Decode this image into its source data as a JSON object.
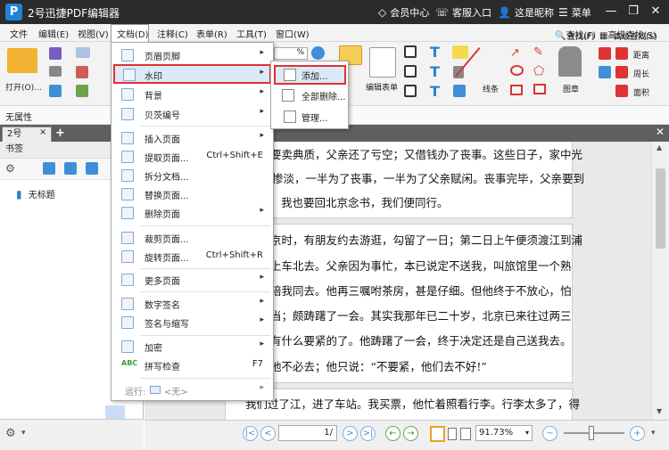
{
  "window": {
    "app_icon_letter": "P",
    "title": "2号迅捷PDF编辑器",
    "member_center": "会员中心",
    "support": "客服入口",
    "username": "这是昵称",
    "menu": "菜单"
  },
  "menubar": [
    "文件",
    "编辑(E)",
    "视图(V)",
    "文档(D)",
    "注释(C)",
    "表单(R)",
    "工具(T)",
    "窗口(W)"
  ],
  "ribbon": {
    "open": "打开(O)...",
    "zoom_value": "%",
    "edit_form": "编辑表单",
    "lines": "线条",
    "stamp": "图章",
    "find": "查找(F)",
    "advanced_find": "高级查找(S)",
    "distance": "距离",
    "perimeter": "周长",
    "area": "面积"
  },
  "property_bar": "无属性",
  "doc_tab": "2号",
  "sidebar": {
    "title": "书签",
    "bookmark": "无标题"
  },
  "page_lines": [
    "要卖典质，父亲还了亏空；又借钱办了丧事。这些日子，家中光",
    "惨淡，一半为了丧事，一半为了父亲赋闲。丧事完毕，父亲要到",
    "我也要回北京念书，我们便同行。",
    "京时，有朋友约去游逛，勾留了一日；第二日上午便须渡江到浦",
    "上车北去。父亲因为事忙，本已说定不送我，叫旅馆里一个熟",
    "陪我同去。他再三嘱咐茶房，甚是仔细。但他终于不放心，怕",
    "当；颇踌躇了一会。其实我那年已二十岁，北京已来往过两三",
    "有什么要紧的了。他踌躇了一会，终于决定还是自己送我去。",
    "他不必去；他只说：“不要紧，他们去不好!”",
    "我们过了江，进了车站。我买票，他忙着照看行李。行李太多了，得"
  ],
  "statusbar": {
    "page_value": "1",
    "page_total": "/",
    "zoom": "91.73%"
  },
  "doc_menu": {
    "items": [
      {
        "label": "页眉页脚",
        "shortcut": "",
        "arrow": "▸"
      },
      {
        "label": "水印",
        "shortcut": "",
        "arrow": "▸"
      },
      {
        "label": "背景",
        "shortcut": "",
        "arrow": "▸"
      },
      {
        "label": "贝茨编号",
        "shortcut": "",
        "arrow": "▸"
      },
      {
        "label": "插入页面",
        "shortcut": "",
        "arrow": "▸"
      },
      {
        "label": "提取页面...",
        "shortcut": "Ctrl+Shift+E",
        "arrow": ""
      },
      {
        "label": "拆分文档...",
        "shortcut": "",
        "arrow": ""
      },
      {
        "label": "替换页面...",
        "shortcut": "",
        "arrow": ""
      },
      {
        "label": "删除页面",
        "shortcut": "",
        "arrow": "▸"
      },
      {
        "label": "裁剪页面...",
        "shortcut": "",
        "arrow": ""
      },
      {
        "label": "旋转页面...",
        "shortcut": "Ctrl+Shift+R",
        "arrow": ""
      },
      {
        "label": "更多页面",
        "shortcut": "",
        "arrow": "▸"
      },
      {
        "label": "数字签名",
        "shortcut": "",
        "arrow": "▸"
      },
      {
        "label": "签名与缩写",
        "shortcut": "",
        "arrow": "▸"
      },
      {
        "label": "加密",
        "shortcut": "",
        "arrow": "▸"
      },
      {
        "label": "拼写检查",
        "shortcut": "F7",
        "arrow": ""
      }
    ],
    "run_label": "运行:",
    "run_value": "<无>"
  },
  "watermark_menu": [
    "添加...",
    "全部删除...",
    "管理..."
  ],
  "colors": {
    "titlebar": "#2b2b2b",
    "highlight": "#dbe9f8",
    "annotation_red": "#e03131",
    "accent_blue": "#1f83d6"
  }
}
